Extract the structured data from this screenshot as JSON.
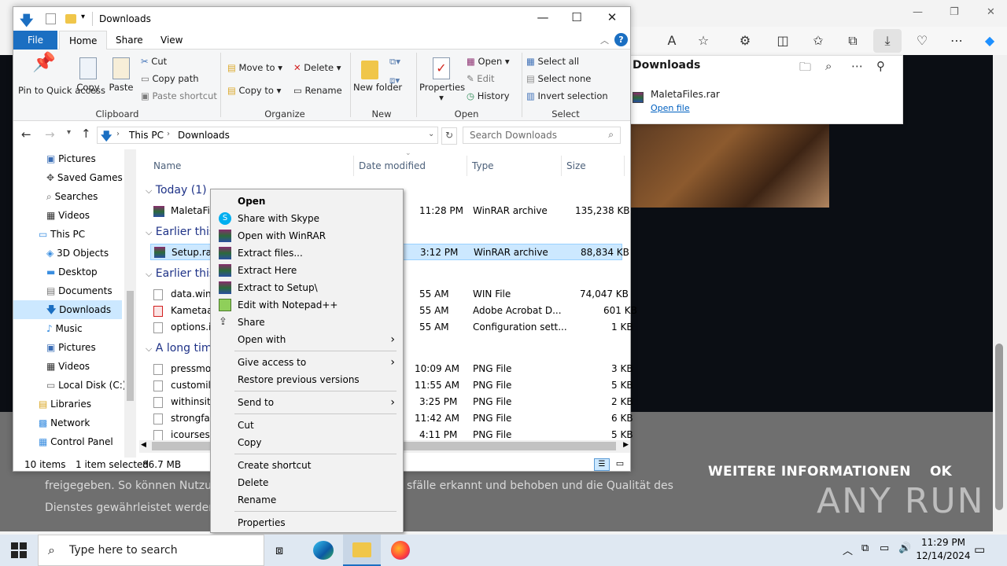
{
  "explorer": {
    "title": "Downloads",
    "tabs": [
      "File",
      "Home",
      "Share",
      "View"
    ],
    "ribbon": {
      "clipboard": {
        "pin": "Pin to Quick access",
        "copy": "Copy",
        "paste": "Paste",
        "cut": "Cut",
        "copy_path": "Copy path",
        "paste_shortcut": "Paste shortcut",
        "label": "Clipboard"
      },
      "organize": {
        "move_to": "Move to",
        "copy_to": "Copy to",
        "delete": "Delete",
        "rename": "Rename",
        "label": "Organize"
      },
      "new": {
        "new_folder": "New folder",
        "label": "New"
      },
      "open": {
        "properties": "Properties",
        "open": "Open",
        "edit": "Edit",
        "history": "History",
        "label": "Open"
      },
      "select": {
        "select_all": "Select all",
        "select_none": "Select none",
        "invert": "Invert selection",
        "label": "Select"
      }
    },
    "address": {
      "this_pc": "This PC",
      "current": "Downloads",
      "search_placeholder": "Search Downloads"
    },
    "nav": [
      "Pictures",
      "Saved Games",
      "Searches",
      "Videos",
      "This PC",
      "3D Objects",
      "Desktop",
      "Documents",
      "Downloads",
      "Music",
      "Pictures",
      "Videos",
      "Local Disk (C:)",
      "Libraries",
      "Network",
      "Control Panel"
    ],
    "columns": {
      "name": "Name",
      "date": "Date modified",
      "type": "Type",
      "size": "Size"
    },
    "groups": [
      "Today (1)",
      "Earlier this",
      "Earlier this",
      "A long tim"
    ],
    "files": [
      {
        "name": "MaletaFile",
        "date": "11:28 PM",
        "type": "WinRAR archive",
        "size": "135,238 KB"
      },
      {
        "name": "Setup.rar",
        "date": "3:12 PM",
        "type": "WinRAR archive",
        "size": "88,834 KB"
      },
      {
        "name": "data.win",
        "date": "55 AM",
        "type": "WIN File",
        "size": "74,047 KB"
      },
      {
        "name": "Kametaa",
        "date": "55 AM",
        "type": "Adobe Acrobat D...",
        "size": "601 KB"
      },
      {
        "name": "options.in",
        "date": "55 AM",
        "type": "Configuration sett...",
        "size": "1 KB"
      },
      {
        "name": "pressmod",
        "date": "10:09 AM",
        "type": "PNG File",
        "size": "3 KB"
      },
      {
        "name": "customilli",
        "date": "11:55 AM",
        "type": "PNG File",
        "size": "5 KB"
      },
      {
        "name": "withinsite",
        "date": "3:25 PM",
        "type": "PNG File",
        "size": "2 KB"
      },
      {
        "name": "strongfam",
        "date": "11:42 AM",
        "type": "PNG File",
        "size": "6 KB"
      },
      {
        "name": "icourses.p",
        "date": "4:11 PM",
        "type": "PNG File",
        "size": "5 KB"
      }
    ],
    "status": {
      "items": "10 items",
      "selected": "1 item selected",
      "size": "86.7 MB"
    }
  },
  "context_menu": [
    "Open",
    "Share with Skype",
    "Open with WinRAR",
    "Extract files...",
    "Extract Here",
    "Extract to Setup\\",
    "Edit with Notepad++",
    "Share",
    "Open with",
    "Give access to",
    "Restore previous versions",
    "Send to",
    "Cut",
    "Copy",
    "Create shortcut",
    "Delete",
    "Rename",
    "Properties"
  ],
  "downloads_panel": {
    "title": "Downloads",
    "file": "MaletaFiles.rar",
    "open_link": "Open file"
  },
  "page": {
    "line1": "freigegeben. So können Nutzur",
    "line1b": "sfälle erkannt und behoben und die Qualität des",
    "line2": "Dienstes gewährleistet werden",
    "more_info": "WEITERE INFORMATIONEN",
    "ok": "OK",
    "watermark": "ANY RUN"
  },
  "taskbar": {
    "search_placeholder": "Type here to search",
    "time": "11:29 PM",
    "date": "12/14/2024"
  }
}
